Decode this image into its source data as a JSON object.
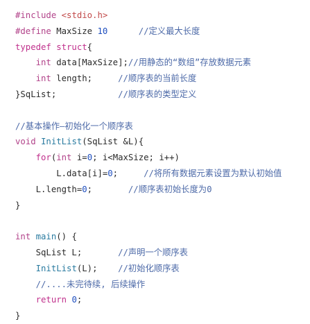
{
  "code_lines": [
    [
      {
        "t": "pp",
        "v": "#include "
      },
      {
        "t": "str",
        "v": "<stdio.h>"
      }
    ],
    [
      {
        "t": "pp",
        "v": "#define "
      },
      {
        "t": "id",
        "v": "MaxSize "
      },
      {
        "t": "num",
        "v": "10"
      },
      {
        "t": "id",
        "v": "      "
      },
      {
        "t": "cm",
        "v": "//定义最大长度"
      }
    ],
    [
      {
        "t": "kw",
        "v": "typedef struct"
      },
      {
        "t": "id",
        "v": "{"
      }
    ],
    [
      {
        "t": "id",
        "v": "    "
      },
      {
        "t": "ty",
        "v": "int "
      },
      {
        "t": "id",
        "v": "data[MaxSize];"
      },
      {
        "t": "cm",
        "v": "//用静态的“数组”存放数据元素"
      }
    ],
    [
      {
        "t": "id",
        "v": "    "
      },
      {
        "t": "ty",
        "v": "int "
      },
      {
        "t": "id",
        "v": "length;     "
      },
      {
        "t": "cm",
        "v": "//顺序表的当前长度"
      }
    ],
    [
      {
        "t": "id",
        "v": "}SqList;            "
      },
      {
        "t": "cm",
        "v": "//顺序表的类型定义"
      }
    ],
    [],
    [
      {
        "t": "cm",
        "v": "//基本操作—初始化一个顺序表"
      }
    ],
    [
      {
        "t": "ty",
        "v": "void "
      },
      {
        "t": "fn",
        "v": "InitList"
      },
      {
        "t": "id",
        "v": "(SqList &L){"
      }
    ],
    [
      {
        "t": "id",
        "v": "    "
      },
      {
        "t": "kw",
        "v": "for"
      },
      {
        "t": "id",
        "v": "("
      },
      {
        "t": "ty",
        "v": "int "
      },
      {
        "t": "id",
        "v": "i="
      },
      {
        "t": "num",
        "v": "0"
      },
      {
        "t": "id",
        "v": "; i<MaxSize; i++)"
      }
    ],
    [
      {
        "t": "id",
        "v": "        L.data[i]="
      },
      {
        "t": "num",
        "v": "0"
      },
      {
        "t": "id",
        "v": ";     "
      },
      {
        "t": "cm",
        "v": "//将所有数据元素设置为默认初始值"
      }
    ],
    [
      {
        "t": "id",
        "v": "    L.length="
      },
      {
        "t": "num",
        "v": "0"
      },
      {
        "t": "id",
        "v": ";       "
      },
      {
        "t": "cm",
        "v": "//顺序表初始长度为0"
      }
    ],
    [
      {
        "t": "id",
        "v": "}"
      }
    ],
    [],
    [
      {
        "t": "ty",
        "v": "int "
      },
      {
        "t": "fn",
        "v": "main"
      },
      {
        "t": "id",
        "v": "() {"
      }
    ],
    [
      {
        "t": "id",
        "v": "    SqList L;       "
      },
      {
        "t": "cm",
        "v": "//声明一个顺序表"
      }
    ],
    [
      {
        "t": "id",
        "v": "    "
      },
      {
        "t": "fn",
        "v": "InitList"
      },
      {
        "t": "id",
        "v": "(L);    "
      },
      {
        "t": "cm",
        "v": "//初始化顺序表"
      }
    ],
    [
      {
        "t": "id",
        "v": "    "
      },
      {
        "t": "cm",
        "v": "//....未完待续, 后续操作"
      }
    ],
    [
      {
        "t": "id",
        "v": "    "
      },
      {
        "t": "kw",
        "v": "return "
      },
      {
        "t": "num",
        "v": "0"
      },
      {
        "t": "id",
        "v": ";"
      }
    ],
    [
      {
        "t": "id",
        "v": "}"
      }
    ]
  ]
}
